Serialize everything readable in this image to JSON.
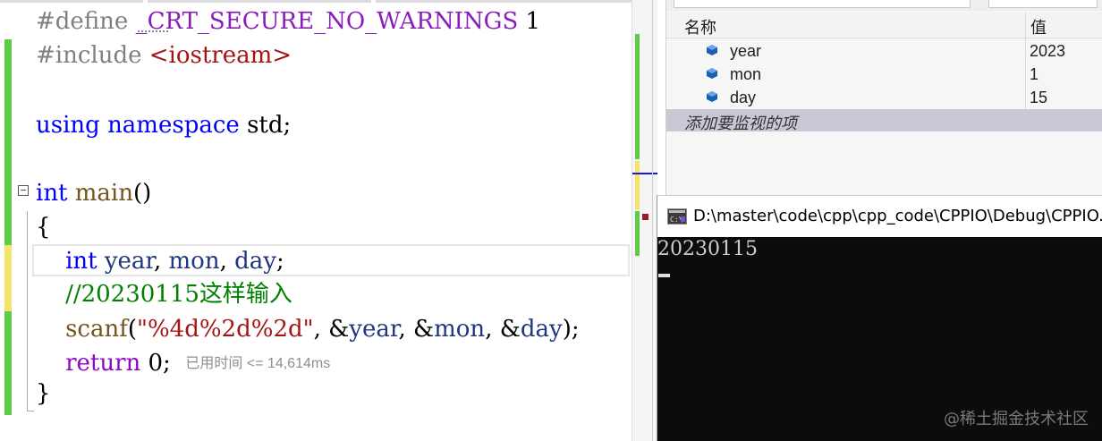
{
  "editor": {
    "lines": {
      "l1_directive": "#define",
      "l1_macro": "_CRT_SECURE_NO_WARNINGS",
      "l1_value": "1",
      "l2_directive": "#include",
      "l2_header": "<iostream>",
      "l4_using": "using",
      "l4_namespace": "namespace",
      "l4_std": "std;",
      "l6_type": "int",
      "l6_fn": "main",
      "l6_parens": "()",
      "l7_brace": "{",
      "l8_type": "int",
      "l8_year": "year",
      "l8_sep1": ", ",
      "l8_mon": "mon",
      "l8_sep2": ", ",
      "l8_day": "day",
      "l8_end": ";",
      "l9_comment": "//20230115这样输入",
      "l10_fn": "scanf",
      "l10_open": "(",
      "l10_str": "\"%4d%2d%2d\"",
      "l10_a1": ", &",
      "l10_year": "year",
      "l10_a2": ", &",
      "l10_mon": "mon",
      "l10_a3": ", &",
      "l10_day": "day",
      "l10_end": ");",
      "l11_return": "return",
      "l11_value": "0;",
      "l11_elapsed": "已用时间 <= 14,614ms",
      "l12_brace": "}"
    },
    "colors": {
      "keyword": "#0000ff",
      "macro": "#8a1bbd",
      "comment": "#008000",
      "string": "#a31515",
      "function": "#74531f",
      "variable": "#1f377f"
    }
  },
  "watch": {
    "columns": {
      "name": "名称",
      "value": "值"
    },
    "rows": [
      {
        "name": "year",
        "value": "2023"
      },
      {
        "name": "mon",
        "value": "1"
      },
      {
        "name": "day",
        "value": "15"
      }
    ],
    "add_item": "添加要监视的项"
  },
  "console": {
    "title": "D:\\master\\code\\cpp\\cpp_code\\CPPIO\\Debug\\CPPIO.exe",
    "output": "20230115",
    "watermark": "@稀土掘金技术社区"
  }
}
